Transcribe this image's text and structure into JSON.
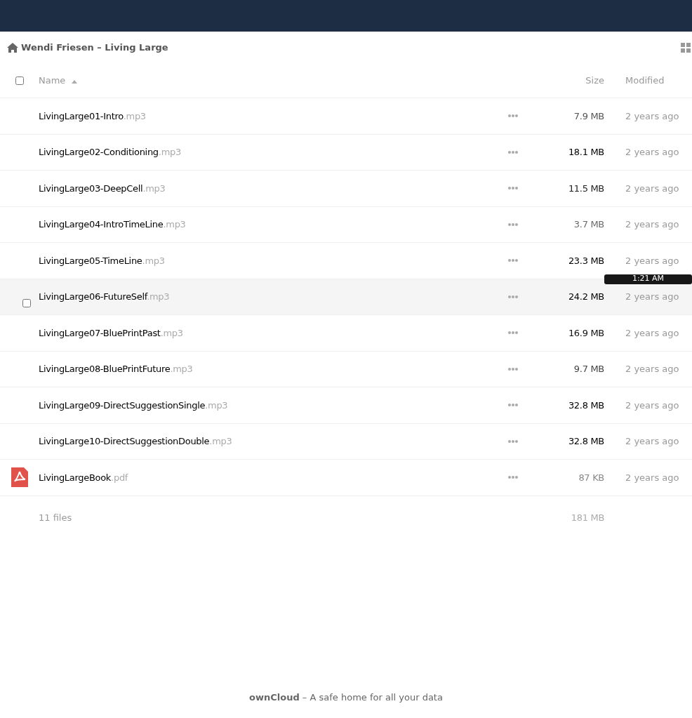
{
  "breadcrumb": {
    "label": "Wendi Friesen – Living Large"
  },
  "columns": {
    "name": "Name",
    "size": "Size",
    "modified": "Modified",
    "sort_ascending": true,
    "all_checked": false
  },
  "files": [
    {
      "kind": "audio",
      "name": "LivingLarge01-Intro",
      "ext": ".mp3",
      "size": "7.9 MB",
      "color": "#555555",
      "modified": "2 years ago",
      "hovered": false
    },
    {
      "kind": "audio",
      "name": "LivingLarge02-Conditioning",
      "ext": ".mp3",
      "size": "18.1 MB",
      "color": "#000000",
      "modified": "2 years ago",
      "hovered": false
    },
    {
      "kind": "audio",
      "name": "LivingLarge03-DeepCell",
      "ext": ".mp3",
      "size": "11.5 MB",
      "color": "#222222",
      "modified": "2 years ago",
      "hovered": false
    },
    {
      "kind": "audio",
      "name": "LivingLarge04-IntroTimeLine",
      "ext": ".mp3",
      "size": "3.7 MB",
      "color": "#6a6a6a",
      "modified": "2 years ago",
      "hovered": false
    },
    {
      "kind": "audio",
      "name": "LivingLarge05-TimeLine",
      "ext": ".mp3",
      "size": "23.3 MB",
      "color": "#000000",
      "modified": "2 years ago",
      "hovered": false
    },
    {
      "kind": "audio",
      "name": "LivingLarge06-FutureSelf",
      "ext": ".mp3",
      "size": "24.2 MB",
      "color": "#000000",
      "modified": "2 years ago",
      "hovered": true,
      "tooltip": "1:21 AM"
    },
    {
      "kind": "audio",
      "name": "LivingLarge07-BluePrintPast",
      "ext": ".mp3",
      "size": "16.9 MB",
      "color": "#111111",
      "modified": "2 years ago",
      "hovered": false
    },
    {
      "kind": "audio",
      "name": "LivingLarge08-BluePrintFuture",
      "ext": ".mp3",
      "size": "9.7 MB",
      "color": "#444444",
      "modified": "2 years ago",
      "hovered": false
    },
    {
      "kind": "audio",
      "name": "LivingLarge09-DirectSuggestionSingle",
      "ext": ".mp3",
      "size": "32.8 MB",
      "color": "#000000",
      "modified": "2 years ago",
      "hovered": false
    },
    {
      "kind": "audio",
      "name": "LivingLarge10-DirectSuggestionDouble",
      "ext": ".mp3",
      "size": "32.8 MB",
      "color": "#000000",
      "modified": "2 years ago",
      "hovered": false
    },
    {
      "kind": "pdf",
      "name": "LivingLargeBook",
      "ext": ".pdf",
      "size": "87 KB",
      "color": "#888888",
      "modified": "2 years ago",
      "hovered": false
    }
  ],
  "summary": {
    "count": "11 files",
    "total": "181 MB"
  },
  "footer": "**ownCloud** – A safe home for all your data"
}
